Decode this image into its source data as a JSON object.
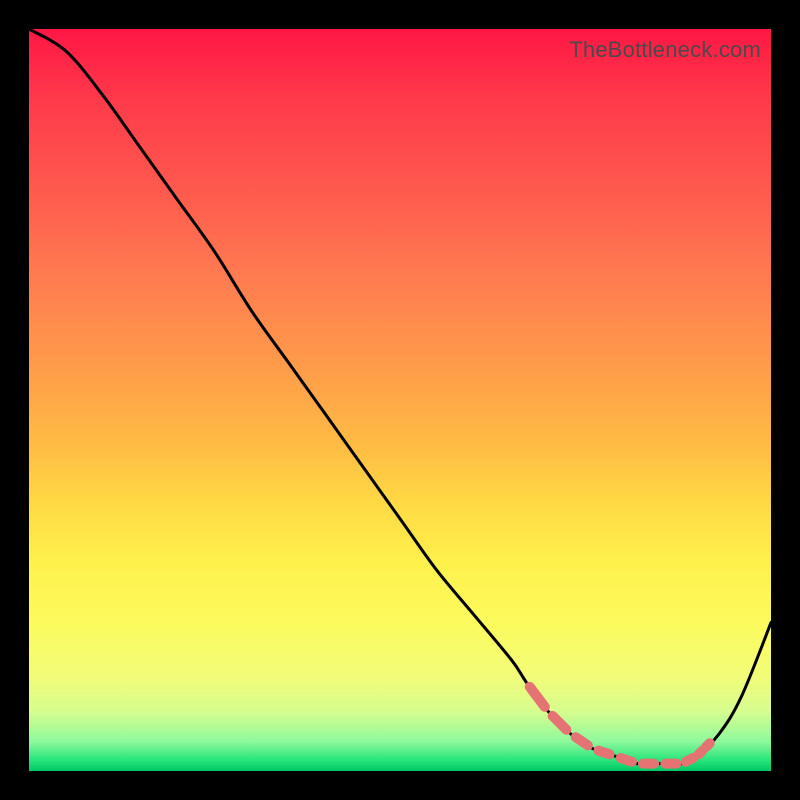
{
  "watermark": "TheBottleneck.com",
  "chart_data": {
    "type": "line",
    "title": "",
    "xlabel": "",
    "ylabel": "",
    "xlim": [
      0,
      100
    ],
    "ylim": [
      0,
      100
    ],
    "series": [
      {
        "name": "curve",
        "color": "#000000",
        "x": [
          0,
          5,
          10,
          15,
          20,
          25,
          30,
          35,
          40,
          45,
          50,
          55,
          60,
          65,
          67,
          70,
          73,
          76,
          79,
          82,
          85,
          88,
          90,
          93,
          96,
          100
        ],
        "y": [
          100,
          97,
          91,
          84,
          77,
          70,
          62,
          55,
          48,
          41,
          34,
          27,
          21,
          15,
          12,
          8,
          5,
          3,
          2,
          1,
          1,
          1,
          2,
          5,
          10,
          20
        ]
      }
    ],
    "highlight": {
      "name": "dashes",
      "color": "#e57373",
      "points": [
        {
          "x": 67,
          "y": 12
        },
        {
          "x": 70,
          "y": 8
        },
        {
          "x": 73,
          "y": 5
        },
        {
          "x": 76,
          "y": 3
        },
        {
          "x": 79,
          "y": 2
        },
        {
          "x": 82,
          "y": 1
        },
        {
          "x": 85,
          "y": 1
        },
        {
          "x": 88,
          "y": 1
        },
        {
          "x": 90,
          "y": 2
        },
        {
          "x": 91,
          "y": 3
        },
        {
          "x": 92,
          "y": 4
        }
      ]
    }
  }
}
